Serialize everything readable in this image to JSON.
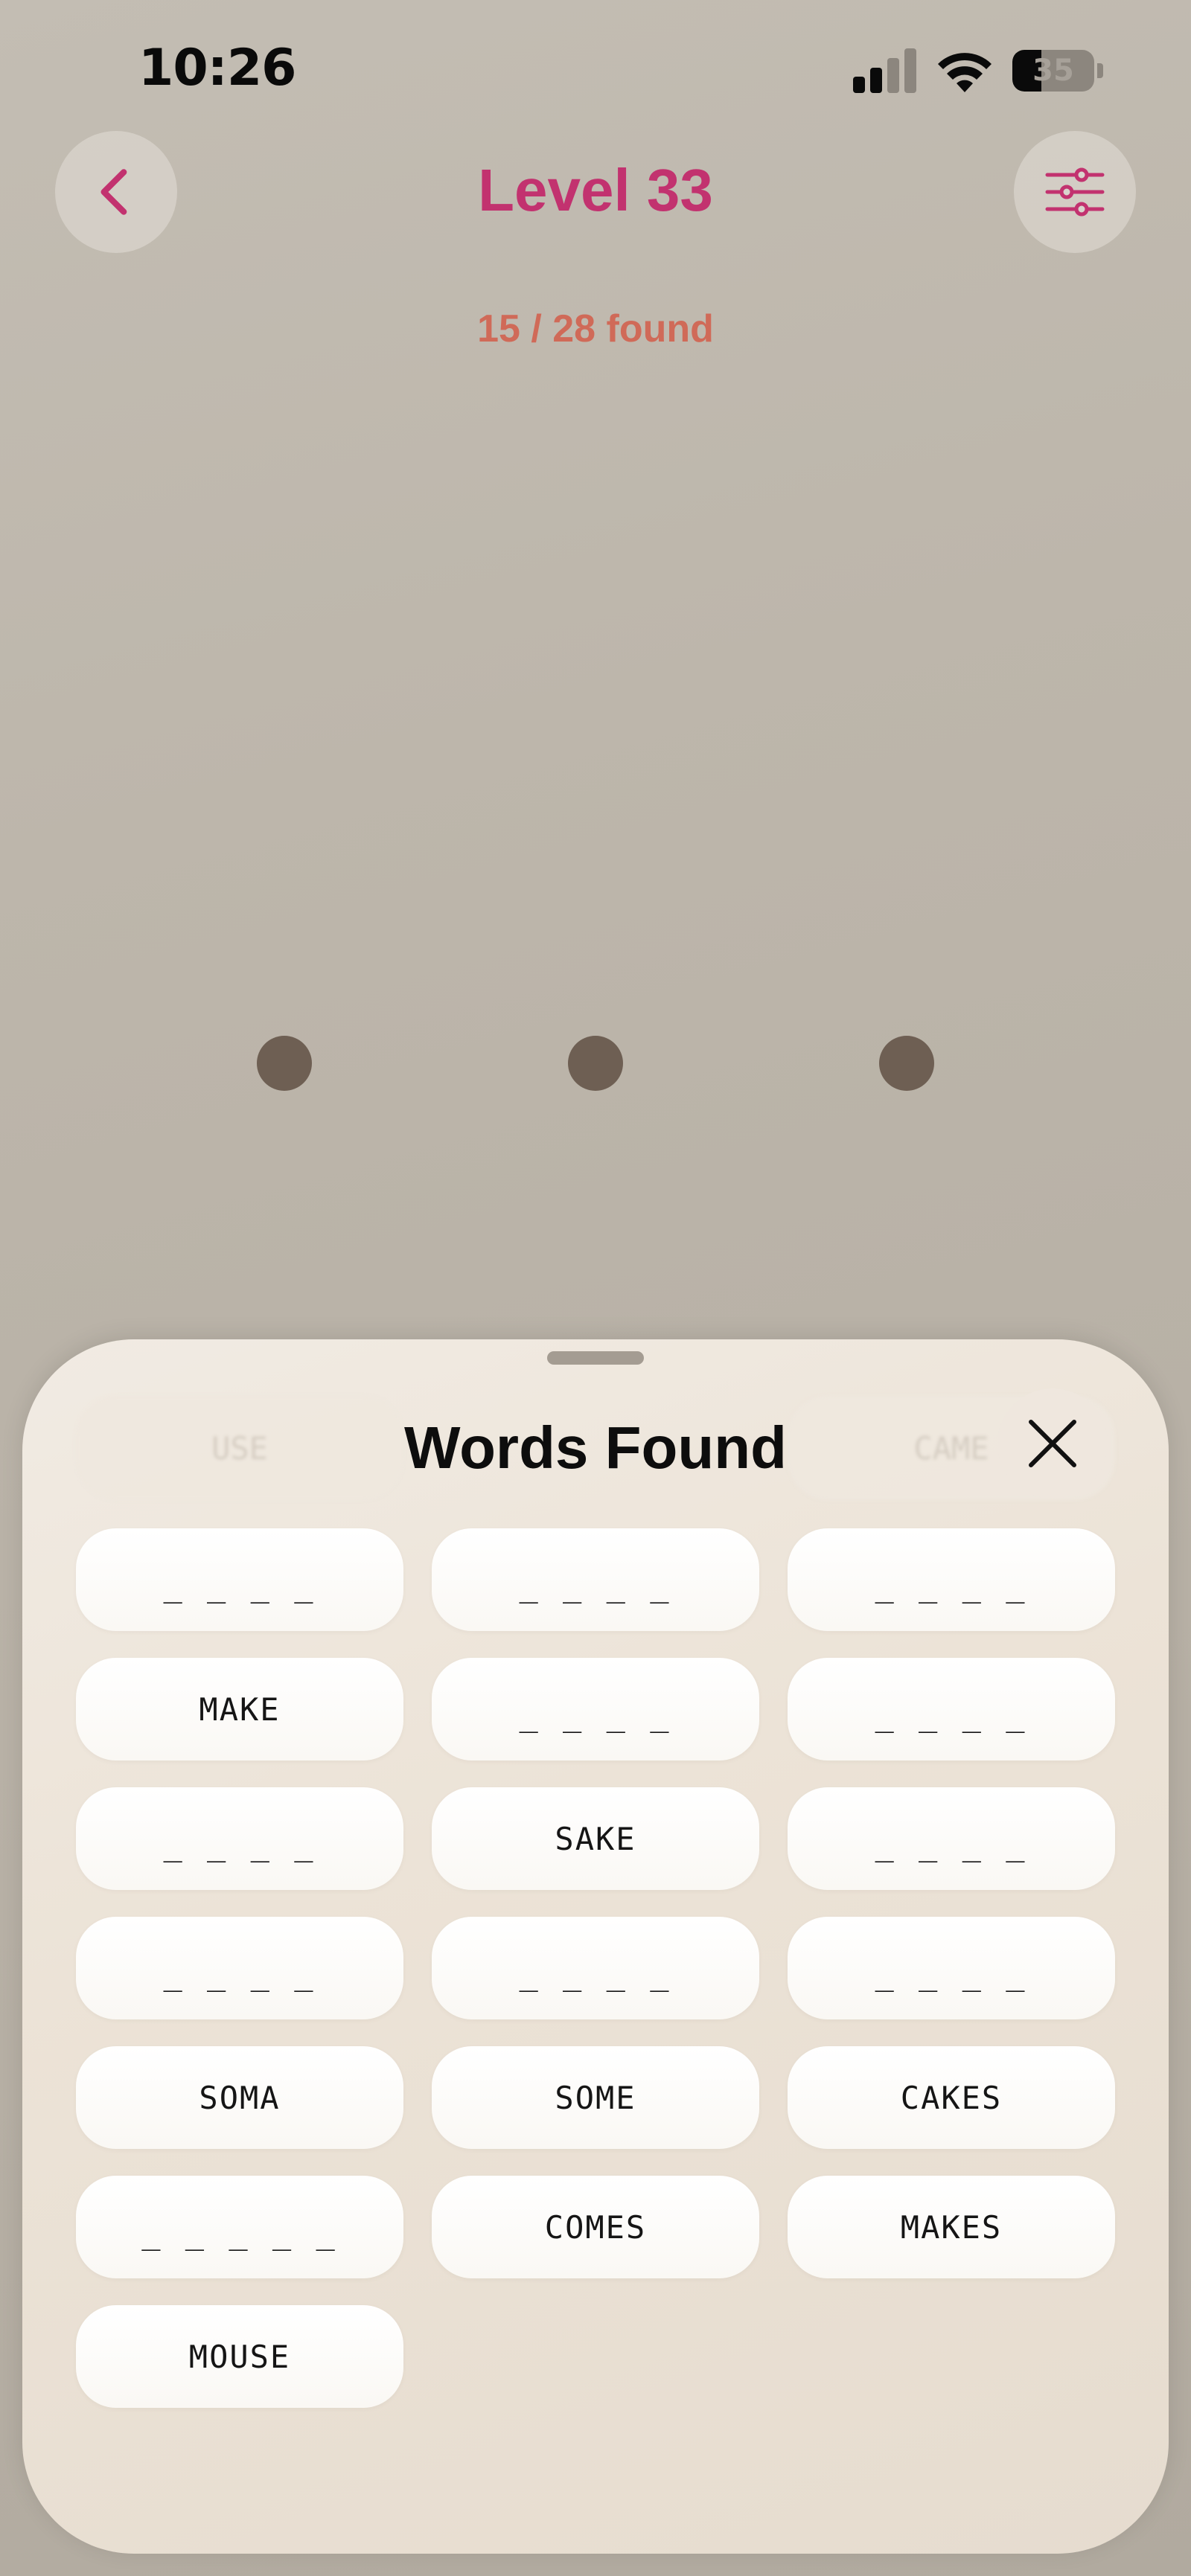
{
  "status_bar": {
    "time": "10:26",
    "battery_level": "35",
    "battery_fraction": 0.35
  },
  "header": {
    "back_icon": "chevron-left-icon",
    "title": "Level 33",
    "settings_icon": "sliders-icon",
    "progress": "15 / 28 found"
  },
  "letter_wheel": {
    "dot_count": 3,
    "dot_color": "#6e5f53"
  },
  "sheet": {
    "title": "Words Found",
    "close_icon": "close-icon",
    "ghost_words": [
      "USE",
      "CAME"
    ],
    "words": [
      {
        "text": "_ _ _ _",
        "found": false
      },
      {
        "text": "_ _ _ _",
        "found": false
      },
      {
        "text": "_ _ _ _",
        "found": false
      },
      {
        "text": "MAKE",
        "found": true
      },
      {
        "text": "_ _ _ _",
        "found": false
      },
      {
        "text": "_ _ _ _",
        "found": false
      },
      {
        "text": "_ _ _ _",
        "found": false
      },
      {
        "text": "SAKE",
        "found": true
      },
      {
        "text": "_ _ _ _",
        "found": false
      },
      {
        "text": "_ _ _ _",
        "found": false
      },
      {
        "text": "_ _ _ _",
        "found": false
      },
      {
        "text": "_ _ _ _",
        "found": false
      },
      {
        "text": "SOMA",
        "found": true
      },
      {
        "text": "SOME",
        "found": true
      },
      {
        "text": "CAKES",
        "found": true
      },
      {
        "text": "_ _ _ _ _",
        "found": false
      },
      {
        "text": "COMES",
        "found": true
      },
      {
        "text": "MAKES",
        "found": true
      },
      {
        "text": "MOUSE",
        "found": true
      }
    ]
  },
  "colors": {
    "accent": "#c2326f",
    "progress": "#d06a58"
  }
}
